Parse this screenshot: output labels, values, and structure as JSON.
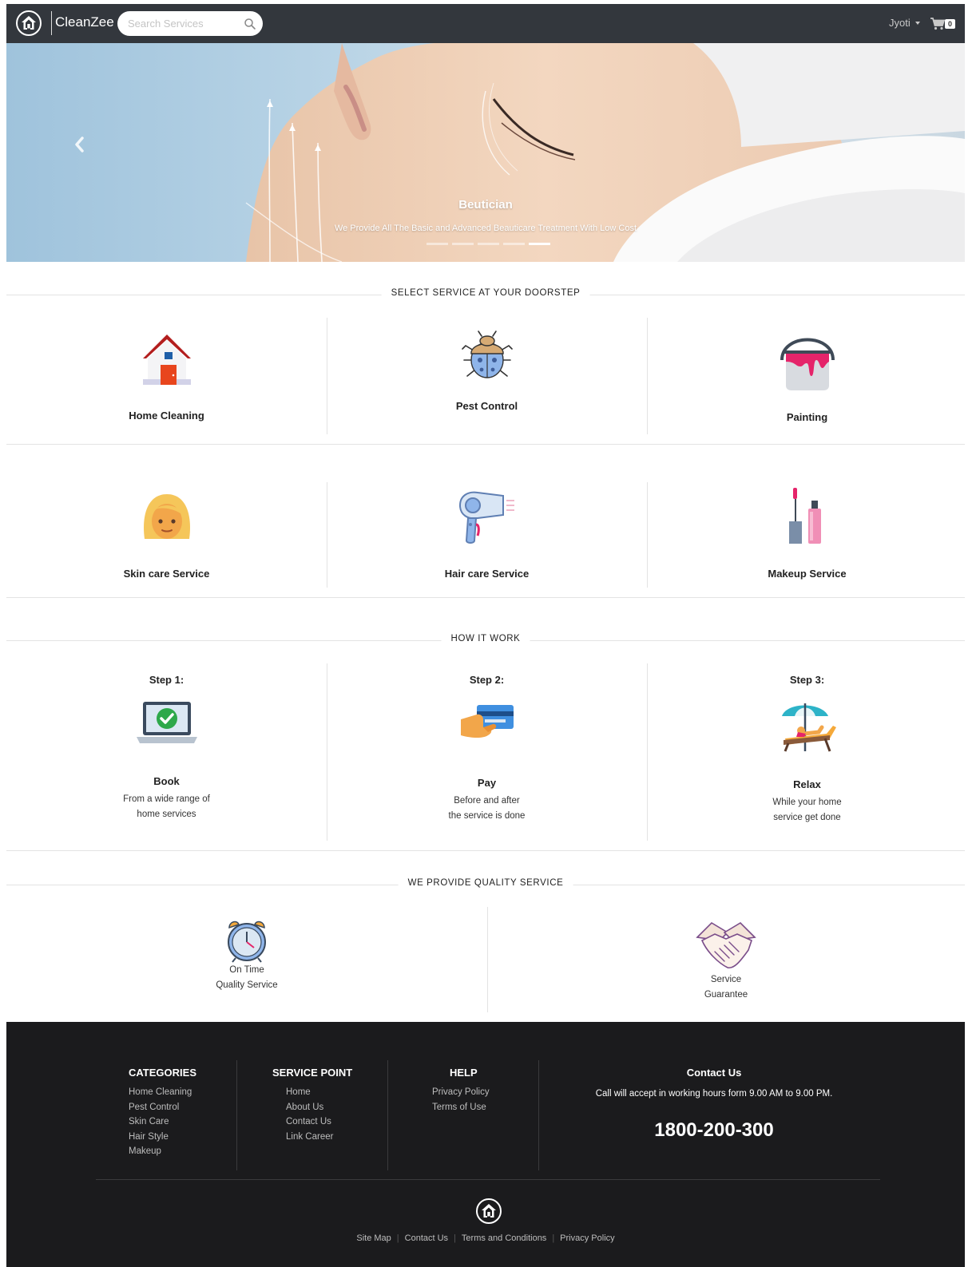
{
  "nav": {
    "brand": "CleanZee",
    "search_placeholder": "Search Services",
    "user": "Jyoti",
    "cart_count": "0"
  },
  "hero": {
    "title": "Beutician",
    "caption": "We Provide All The Basic and Advanced Beauticare Treatment With Low Cost",
    "slide_count": 5,
    "active_slide": 5
  },
  "services": {
    "heading": "SELECT SERVICE AT YOUR DOORSTEP",
    "items": [
      {
        "label": "Home Cleaning",
        "icon": "house-icon"
      },
      {
        "label": "Pest Control",
        "icon": "bug-icon"
      },
      {
        "label": "Painting",
        "icon": "paint-bucket-icon"
      },
      {
        "label": "Skin care Service",
        "icon": "woman-face-icon"
      },
      {
        "label": "Hair care Service",
        "icon": "hair-dryer-icon"
      },
      {
        "label": "Makeup Service",
        "icon": "lipstick-icon"
      }
    ]
  },
  "how": {
    "heading": "HOW IT WORK",
    "steps": [
      {
        "title": "Step 1:",
        "name": "Book",
        "desc1": "From a wide range of",
        "desc2": "home services",
        "icon": "laptop-check-icon"
      },
      {
        "title": "Step 2:",
        "name": "Pay",
        "desc1": "Before and after",
        "desc2": "the service is done",
        "icon": "card-payment-icon"
      },
      {
        "title": "Step 3:",
        "name": "Relax",
        "desc1": "While your home",
        "desc2": "service get done",
        "icon": "beach-chair-icon"
      }
    ]
  },
  "quality": {
    "heading": "WE PROVIDE QUALITY SERVICE",
    "items": [
      {
        "line1": "On Time",
        "line2": "Quality Service",
        "icon": "alarm-clock-icon"
      },
      {
        "line1": "Service",
        "line2": "Guarantee",
        "icon": "handshake-icon"
      }
    ]
  },
  "footer": {
    "categories": {
      "title": "CATEGORIES",
      "items": [
        "Home Cleaning",
        "Pest Control",
        "Skin Care",
        "Hair Style",
        "Makeup"
      ]
    },
    "service_point": {
      "title": "SERVICE POINT",
      "items": [
        "Home",
        "About Us",
        "Contact Us",
        "Link Career"
      ]
    },
    "help": {
      "title": "HELP",
      "items": [
        "Privacy Policy",
        "Terms of Use"
      ]
    },
    "contact": {
      "title": "Contact Us",
      "text": "Call will accept in working hours form 9.00 AM to 9.00 PM.",
      "phone": "1800-200-300"
    },
    "bottom_links": [
      "Site Map",
      "Contact Us",
      "Terms and Conditions",
      "Privacy Policy"
    ]
  },
  "colors": {
    "navbar": "#33373d",
    "footer": "#1b1b1d",
    "divider": "#e3e3e3"
  }
}
